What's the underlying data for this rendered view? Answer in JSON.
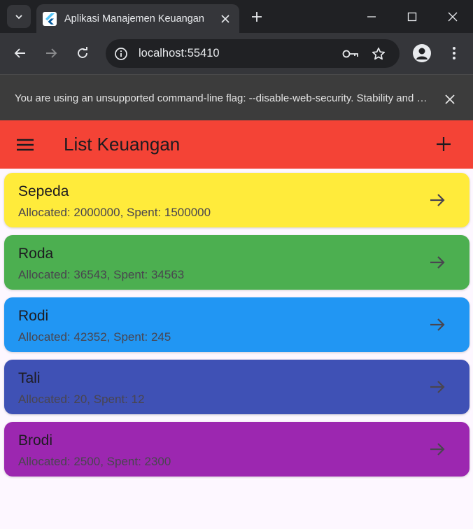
{
  "browser": {
    "tab_title": "Aplikasi Manajemen Keuangan",
    "url": "localhost:55410",
    "infobar_text": "You are using an unsupported command-line flag: --disable-web-security. Stability and security will suffer."
  },
  "app": {
    "title": "List Keuangan",
    "accent_color": "#f44336"
  },
  "items": [
    {
      "name": "Sepeda",
      "details": "Allocated: 2000000, Spent: 1500000",
      "color": "#ffeb3b"
    },
    {
      "name": "Roda",
      "details": "Allocated: 36543, Spent: 34563",
      "color": "#4caf50"
    },
    {
      "name": "Rodi",
      "details": "Allocated: 42352, Spent: 245",
      "color": "#2196f3"
    },
    {
      "name": "Tali",
      "details": "Allocated: 20, Spent: 12",
      "color": "#3f51b5"
    },
    {
      "name": "Brodi",
      "details": "Allocated: 2500, Spent: 2300",
      "color": "#9c27b0"
    }
  ]
}
